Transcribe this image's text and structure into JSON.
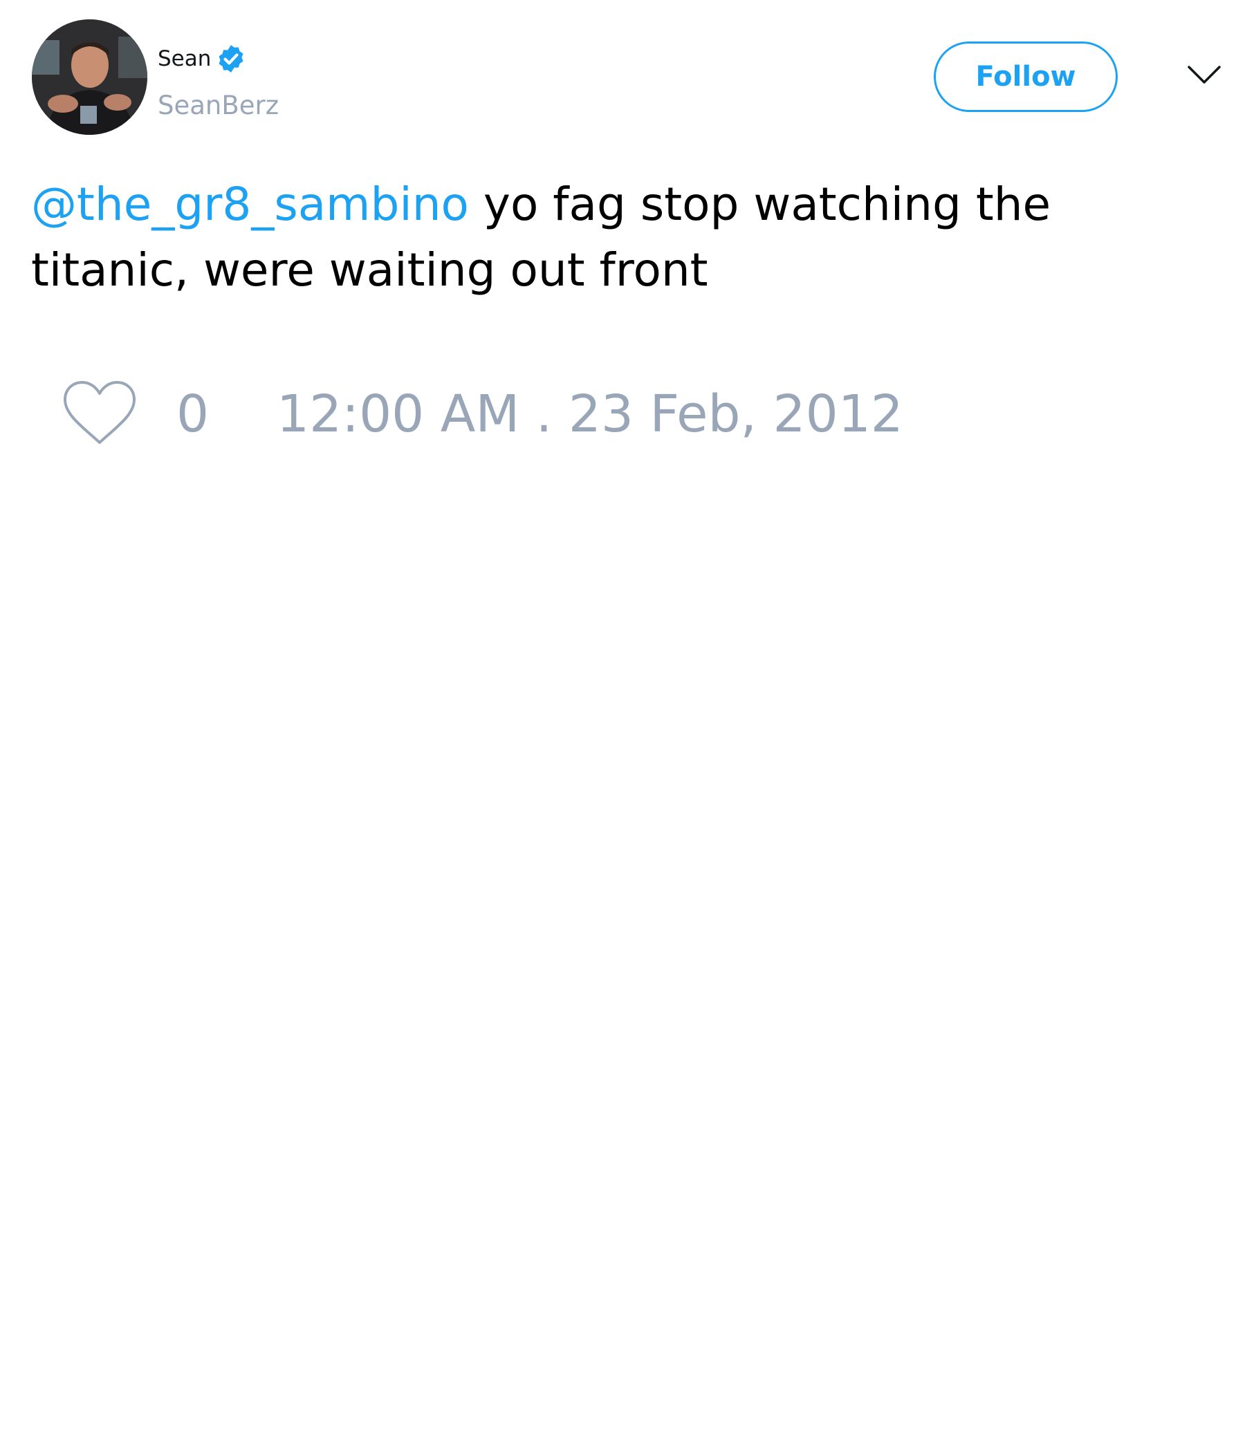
{
  "author": {
    "display_name": "Sean",
    "handle": "SeanBerz",
    "verified": true
  },
  "follow_button": {
    "label": "Follow"
  },
  "tweet": {
    "mention": "@the_gr8_sambino",
    "text": " yo fag stop watching the titanic, were waiting out front"
  },
  "stats": {
    "likes": "0",
    "timestamp": "12:00 AM . 23 Feb, 2012"
  },
  "icons": {
    "verified": "verified-badge-icon",
    "menu": "chevron-down-icon",
    "like": "heart-icon"
  },
  "colors": {
    "accent": "#1da1f2",
    "muted": "#98a6b7",
    "text": "#000000"
  }
}
